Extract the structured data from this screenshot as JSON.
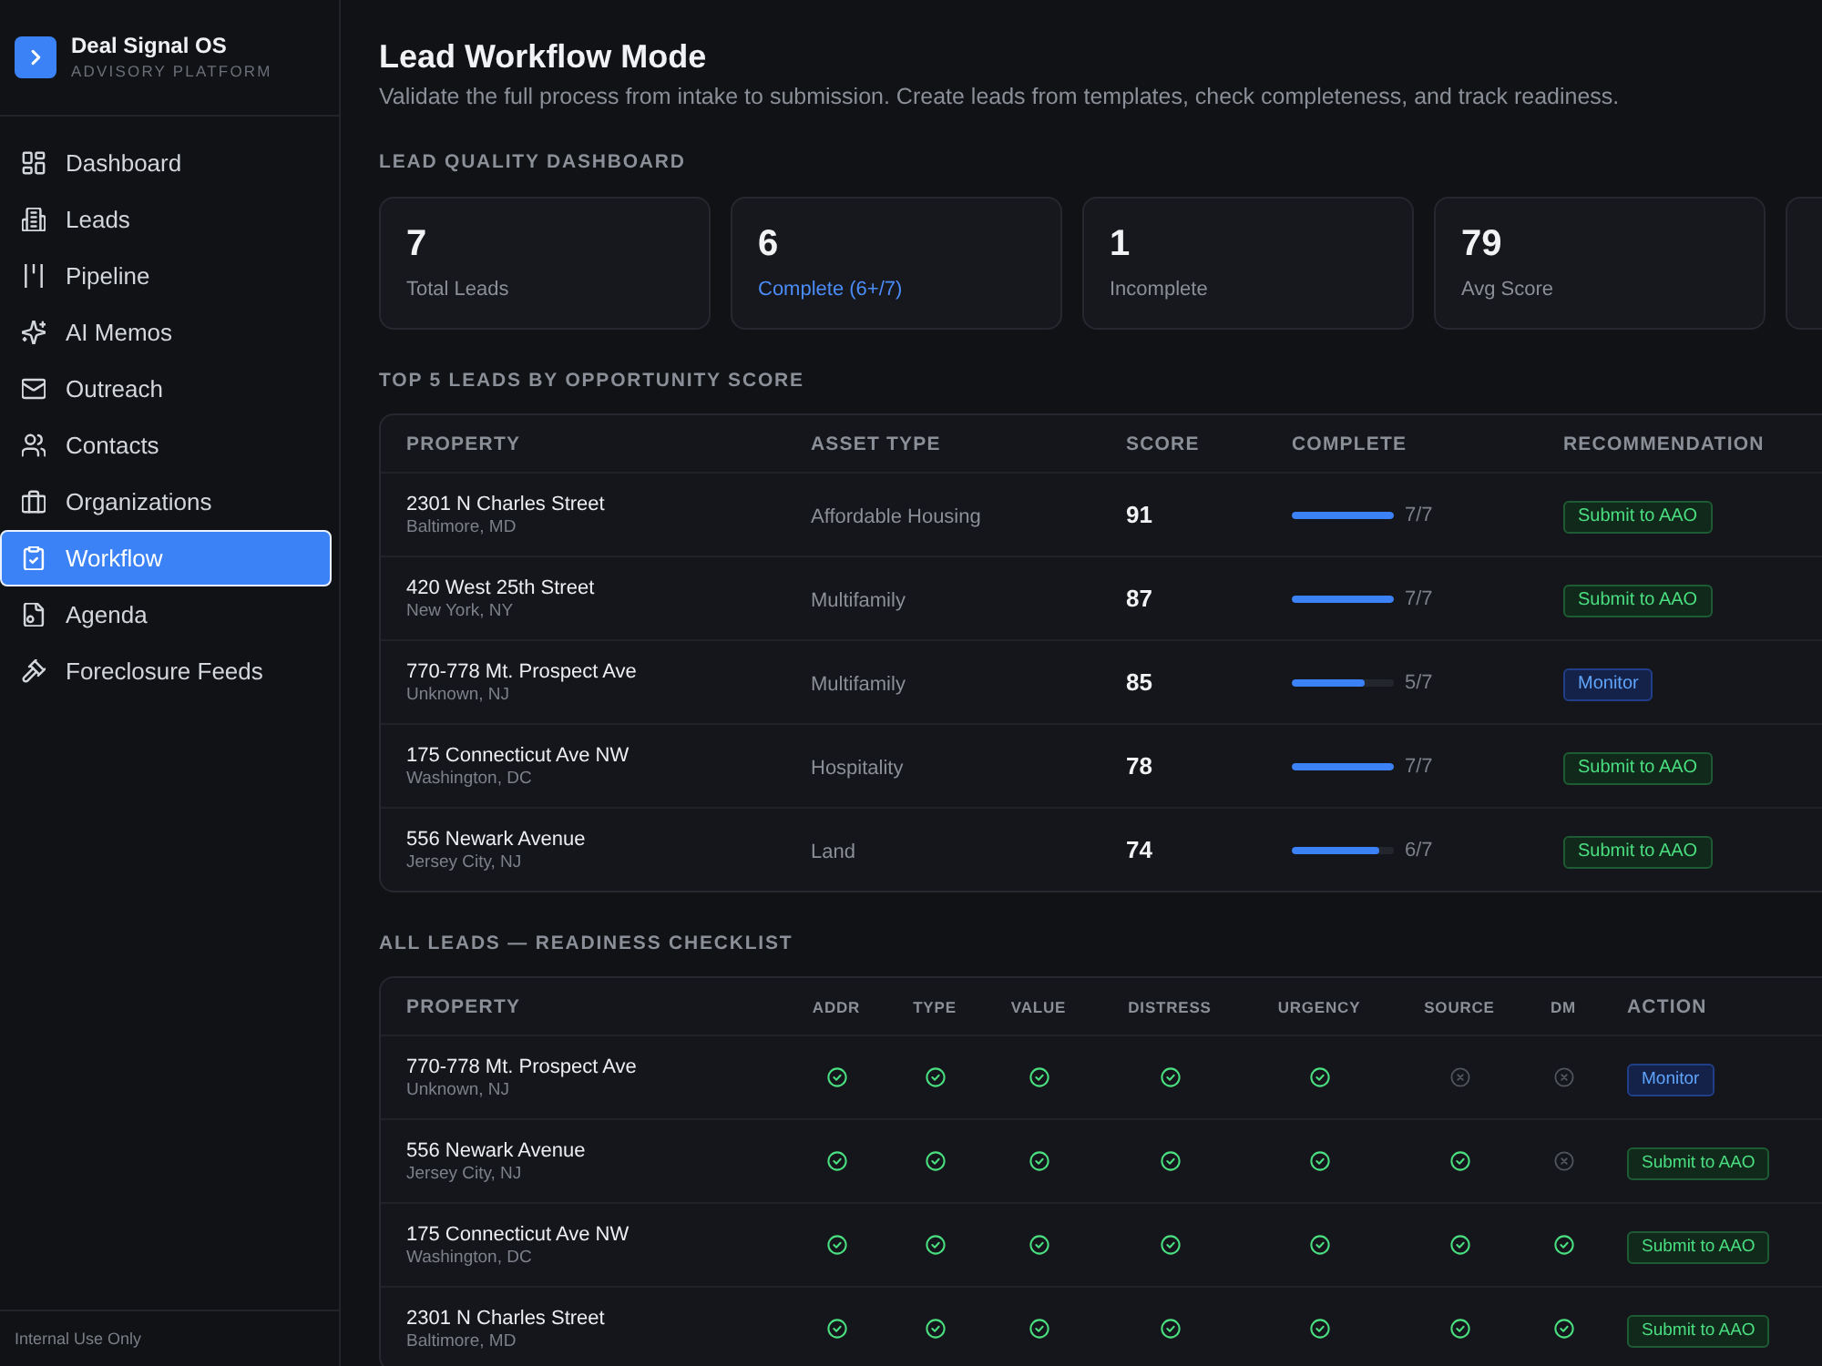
{
  "sidebar": {
    "brand": {
      "title": "Deal Signal OS",
      "subtitle": "ADVISORY PLATFORM"
    },
    "nav": [
      {
        "label": "Dashboard",
        "selected": false
      },
      {
        "label": "Leads",
        "selected": false
      },
      {
        "label": "Pipeline",
        "selected": false
      },
      {
        "label": "AI Memos",
        "selected": false
      },
      {
        "label": "Outreach",
        "selected": false
      },
      {
        "label": "Contacts",
        "selected": false
      },
      {
        "label": "Organizations",
        "selected": false
      },
      {
        "label": "Workflow",
        "selected": true
      },
      {
        "label": "Agenda",
        "selected": false
      },
      {
        "label": "Foreclosure Feeds",
        "selected": false
      }
    ],
    "footer": "Internal Use Only"
  },
  "header": {
    "title": "Lead Workflow Mode",
    "subtitle": "Validate the full process from intake to submission. Create leads from templates, check completeness, and track readiness."
  },
  "quality_dashboard": {
    "heading": "LEAD QUALITY DASHBOARD",
    "cards": [
      {
        "value": "7",
        "label": "Total Leads",
        "color": "#8b8f98"
      },
      {
        "value": "6",
        "label": "Complete (6+/7)",
        "color": "#4b8df8"
      },
      {
        "value": "1",
        "label": "Incomplete",
        "color": "#8b8f98"
      },
      {
        "value": "79",
        "label": "Avg Score",
        "color": "#8b8f98"
      }
    ]
  },
  "top_leads": {
    "heading": "TOP 5 LEADS BY OPPORTUNITY SCORE",
    "columns": [
      "PROPERTY",
      "ASSET TYPE",
      "SCORE",
      "COMPLETE",
      "RECOMMENDATION"
    ],
    "rows": [
      {
        "property": "2301 N Charles Street",
        "location": "Baltimore, MD",
        "asset_type": "Affordable Housing",
        "score": "91",
        "complete": {
          "level": 1,
          "reading": "7/7"
        },
        "recommendation": {
          "label": "Submit to AAO",
          "kind": "submit"
        }
      },
      {
        "property": "420 West 25th Street",
        "location": "New York, NY",
        "asset_type": "Multifamily",
        "score": "87",
        "complete": {
          "level": 1,
          "reading": "7/7"
        },
        "recommendation": {
          "label": "Submit to AAO",
          "kind": "submit"
        }
      },
      {
        "property": "770-778 Mt. Prospect Ave",
        "location": "Unknown, NJ",
        "asset_type": "Multifamily",
        "score": "85",
        "complete": {
          "level": 0.714,
          "reading": "5/7"
        },
        "recommendation": {
          "label": "Monitor",
          "kind": "monitor"
        }
      },
      {
        "property": "175 Connecticut Ave NW",
        "location": "Washington, DC",
        "asset_type": "Hospitality",
        "score": "78",
        "complete": {
          "level": 1,
          "reading": "7/7"
        },
        "recommendation": {
          "label": "Submit to AAO",
          "kind": "submit"
        }
      },
      {
        "property": "556 Newark Avenue",
        "location": "Jersey City, NJ",
        "asset_type": "Land",
        "score": "74",
        "complete": {
          "level": 0.857,
          "reading": "6/7"
        },
        "recommendation": {
          "label": "Submit to AAO",
          "kind": "submit"
        }
      }
    ]
  },
  "checklist": {
    "heading": "ALL LEADS — READINESS CHECKLIST",
    "columns": [
      "PROPERTY",
      "ADDR",
      "TYPE",
      "VALUE",
      "DISTRESS",
      "URGENCY",
      "SOURCE",
      "DM",
      "ACTION"
    ],
    "rows": [
      {
        "property": "770-778 Mt. Prospect Ave",
        "location": "Unknown, NJ",
        "checks": [
          {
            "checked": true
          },
          {
            "checked": true
          },
          {
            "checked": true
          },
          {
            "checked": true
          },
          {
            "checked": true
          },
          {
            "checked": false
          },
          {
            "checked": false
          }
        ],
        "action": {
          "label": "Monitor",
          "kind": "monitor"
        }
      },
      {
        "property": "556 Newark Avenue",
        "location": "Jersey City, NJ",
        "checks": [
          {
            "checked": true
          },
          {
            "checked": true
          },
          {
            "checked": true
          },
          {
            "checked": true
          },
          {
            "checked": true
          },
          {
            "checked": true
          },
          {
            "checked": false
          }
        ],
        "action": {
          "label": "Submit to AAO",
          "kind": "submit"
        }
      },
      {
        "property": "175 Connecticut Ave NW",
        "location": "Washington, DC",
        "checks": [
          {
            "checked": true
          },
          {
            "checked": true
          },
          {
            "checked": true
          },
          {
            "checked": true
          },
          {
            "checked": true
          },
          {
            "checked": true
          },
          {
            "checked": true
          }
        ],
        "action": {
          "label": "Submit to AAO",
          "kind": "submit"
        }
      },
      {
        "property": "2301 N Charles Street",
        "location": "Baltimore, MD",
        "checks": [
          {
            "checked": true
          },
          {
            "checked": true
          },
          {
            "checked": true
          },
          {
            "checked": true
          },
          {
            "checked": true
          },
          {
            "checked": true
          },
          {
            "checked": true
          }
        ],
        "action": {
          "label": "Submit to AAO",
          "kind": "submit"
        }
      }
    ]
  }
}
